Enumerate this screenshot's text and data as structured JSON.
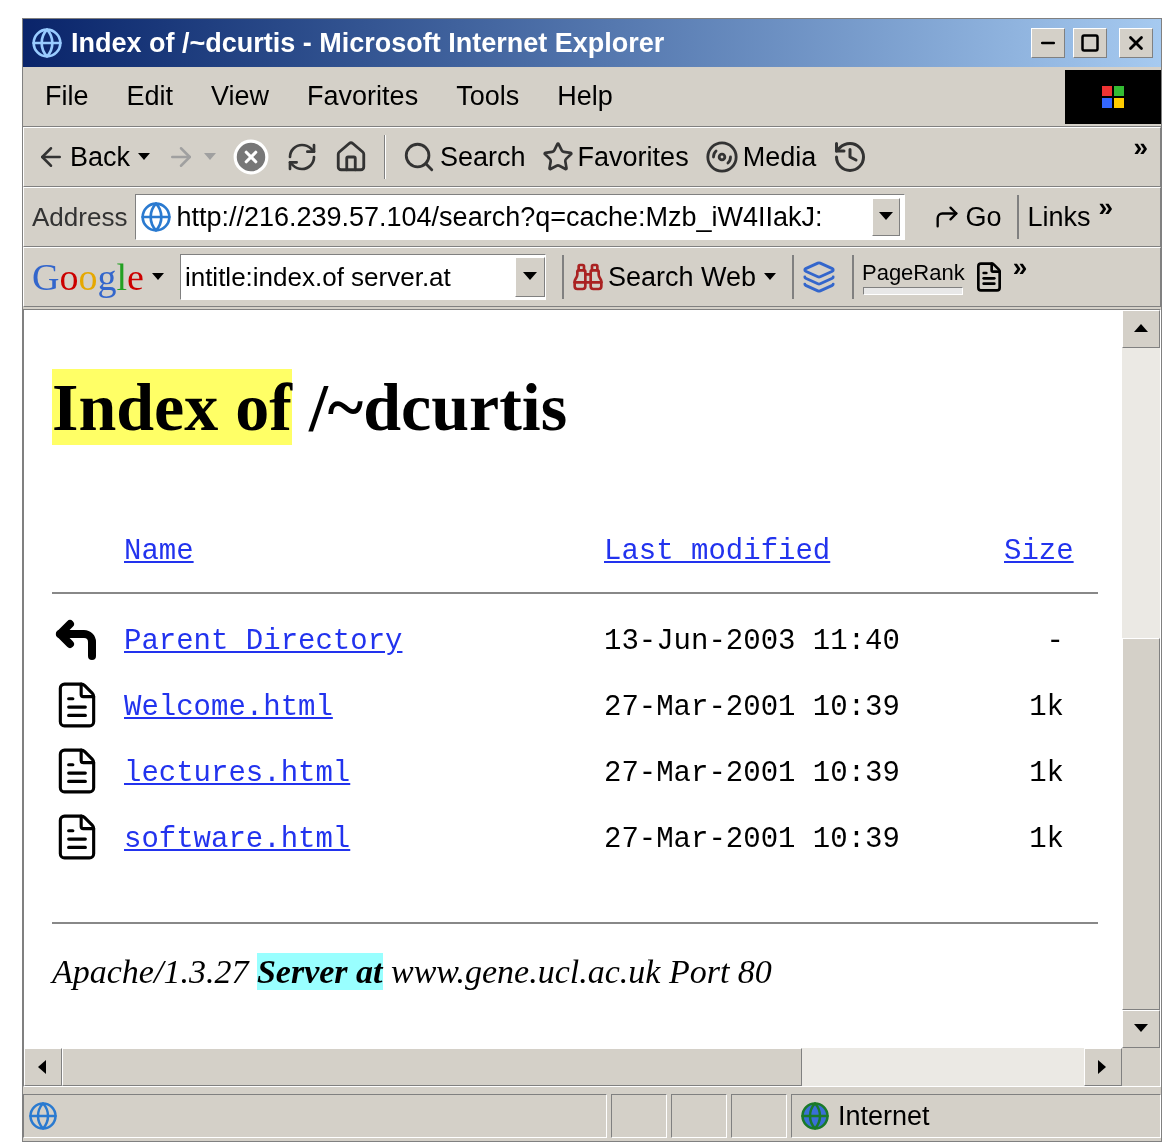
{
  "window": {
    "title": "Index of /~dcurtis - Microsoft Internet Explorer"
  },
  "menu": [
    "File",
    "Edit",
    "View",
    "Favorites",
    "Tools",
    "Help"
  ],
  "toolbar": {
    "buttons": [
      {
        "kind": "back",
        "label": "Back",
        "dropdown": true,
        "disabled": false
      },
      {
        "kind": "forward",
        "dropdown": true,
        "disabled": true
      },
      {
        "kind": "stop",
        "disabled": false
      },
      {
        "kind": "refresh",
        "disabled": false
      },
      {
        "kind": "home",
        "disabled": false
      },
      {
        "kind": "separator"
      },
      {
        "kind": "search",
        "label": "Search",
        "disabled": false
      },
      {
        "kind": "favorites",
        "label": "Favorites",
        "disabled": false
      },
      {
        "kind": "media",
        "label": "Media",
        "disabled": false
      },
      {
        "kind": "history",
        "disabled": false
      }
    ],
    "overflow": "»"
  },
  "address_bar": {
    "label": "Address",
    "value": "http://216.239.57.104/search?q=cache:Mzb_iW4IIakJ:",
    "go": "Go",
    "links": "Links",
    "overflow": "»"
  },
  "google_bar": {
    "logo": "Google",
    "query": "intitle:index.of server.at",
    "search_button": "Search Web",
    "pagerank": "PageRank",
    "overflow": "»"
  },
  "page": {
    "heading": {
      "highlighted": "Index of",
      "rest": " /~dcurtis"
    },
    "columns": [
      "Name",
      "Last modified",
      "Size"
    ],
    "rows": [
      {
        "kind": "parent",
        "name": "Parent Directory",
        "modified": "13-Jun-2003 11:40",
        "size": "-"
      },
      {
        "kind": "file",
        "name": "Welcome.html",
        "modified": "27-Mar-2001 10:39",
        "size": "1k"
      },
      {
        "kind": "file",
        "name": "lectures.html",
        "modified": "27-Mar-2001 10:39",
        "size": "1k"
      },
      {
        "kind": "file",
        "name": "software.html",
        "modified": "27-Mar-2001 10:39",
        "size": "1k"
      }
    ],
    "footer": {
      "before": "Apache/1.3.27 ",
      "highlighted": "Server at",
      "after": " www.gene.ucl.ac.uk Port 80"
    }
  },
  "status_bar": {
    "zone": "Internet"
  }
}
